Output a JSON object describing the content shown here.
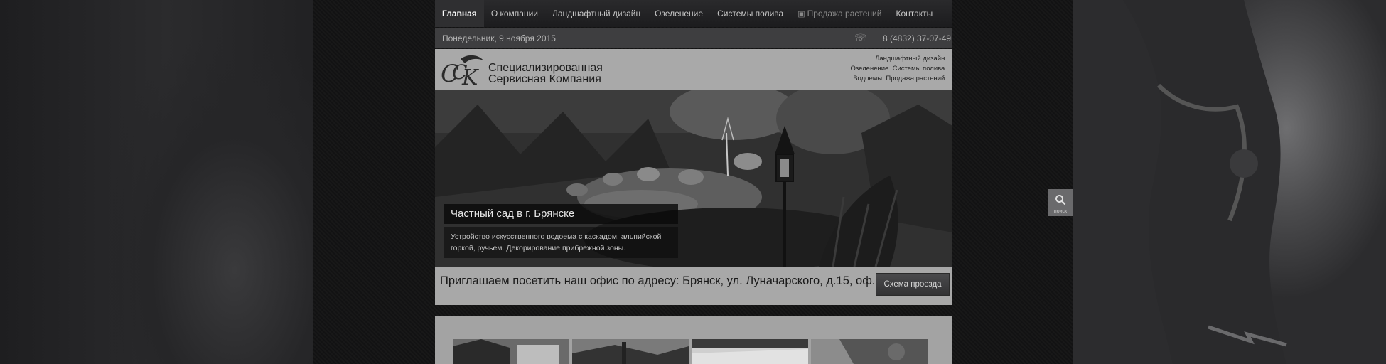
{
  "nav": {
    "items": [
      {
        "label": "Главная"
      },
      {
        "label": "О компании"
      },
      {
        "label": "Ландшафтный дизайн"
      },
      {
        "label": "Озеленение"
      },
      {
        "label": "Системы полива"
      },
      {
        "label": "Продажа растений",
        "icon": "gift-icon"
      },
      {
        "label": "Контакты"
      }
    ]
  },
  "infobar": {
    "date": "Понедельник, 9 ноября 2015",
    "phone": "8 (4832) 37-07-49",
    "phone_icon": "phone-icon"
  },
  "header": {
    "company_line1": "Специализированная",
    "company_line2": "Сервисная Компания",
    "tagline_line1": "Ландшафтный дизайн.",
    "tagline_line2": "Озеленение. Системы полива.",
    "tagline_line3": "Водоемы. Продажа растений."
  },
  "slider": {
    "title": "Частный сад в г. Брянске",
    "text": "Устройство искусственного водоема с каскадом, альпийской горкой, ручьем. Декорирование прибрежной зоны."
  },
  "address": {
    "text": "Приглашаем посетить наш офис по адресу: Брянск, ул. Луначарского, д.15, оф.5",
    "button_label": "Схема проезда"
  },
  "search_widget": {
    "label": "поиск",
    "icon": "search-icon"
  },
  "colors": {
    "nav_bg": "#1c1c1e",
    "header_bg": "#a9a9a9",
    "button_bg": "#3e3e40"
  }
}
